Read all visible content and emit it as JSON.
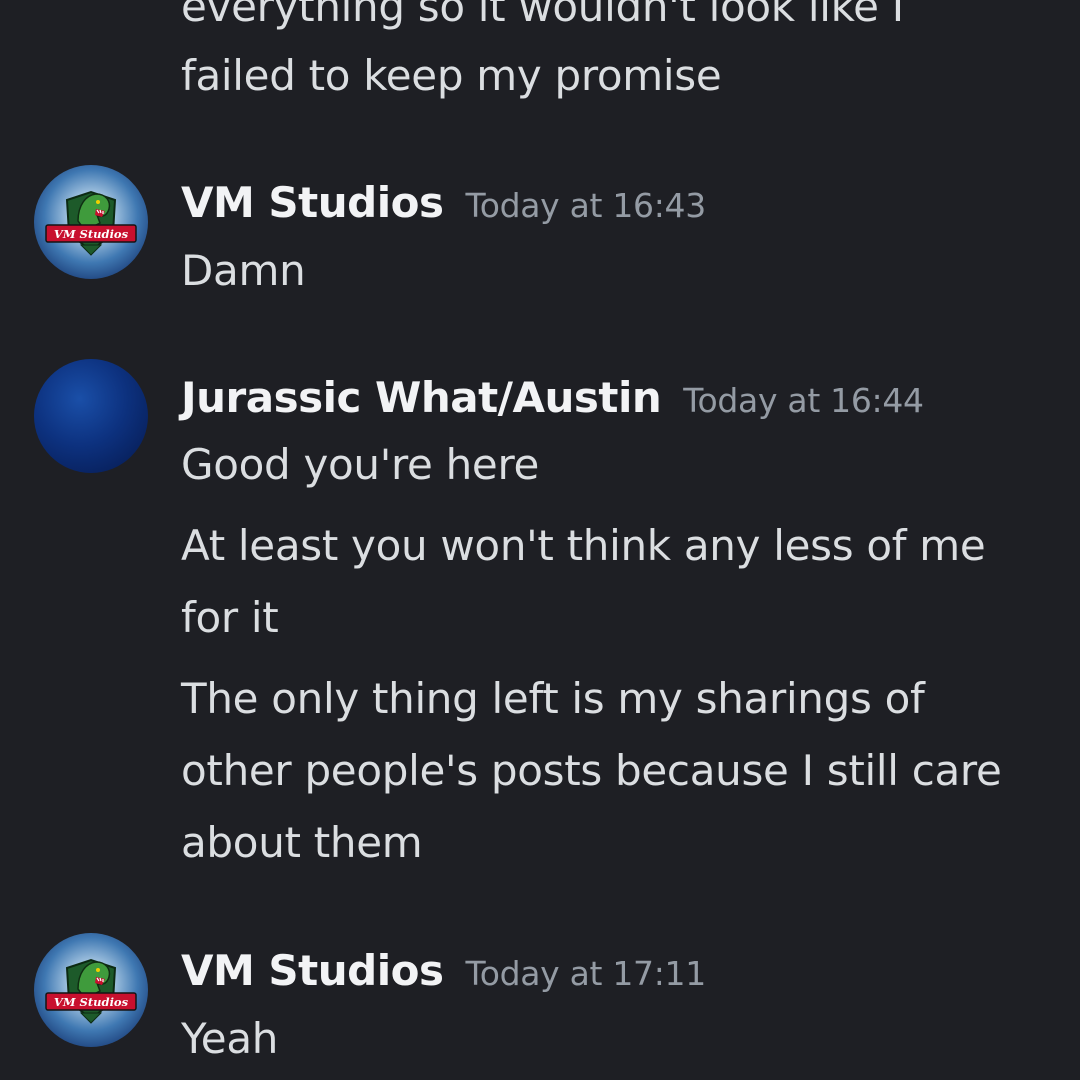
{
  "messages": [
    {
      "continuation": true,
      "lines": [
        "everything so it wouldn't look like I",
        "failed to keep my promise"
      ]
    },
    {
      "author": "VM Studios",
      "timestamp": "Today at 16:43",
      "avatar": "vm-studios-dino-logo",
      "avatar_text": "VM Studios",
      "lines": [
        "Damn"
      ]
    },
    {
      "author": "Jurassic What/Austin",
      "timestamp": "Today at 16:44",
      "avatar": "blue-circle-avatar",
      "lines": [
        "Good you're here",
        "At least you won't think any less of me",
        "for it",
        "The only thing left is my sharings of",
        "other people's posts because I still care",
        "about them"
      ]
    },
    {
      "author": "VM Studios",
      "timestamp": "Today at 17:11",
      "avatar": "vm-studios-dino-logo",
      "avatar_text": "VM Studios",
      "lines": [
        "Yeah"
      ]
    }
  ],
  "colors": {
    "background": "#1e1f24",
    "message_text": "#dbdee1",
    "author_text": "#f2f3f5",
    "timestamp_text": "#949ba4"
  }
}
